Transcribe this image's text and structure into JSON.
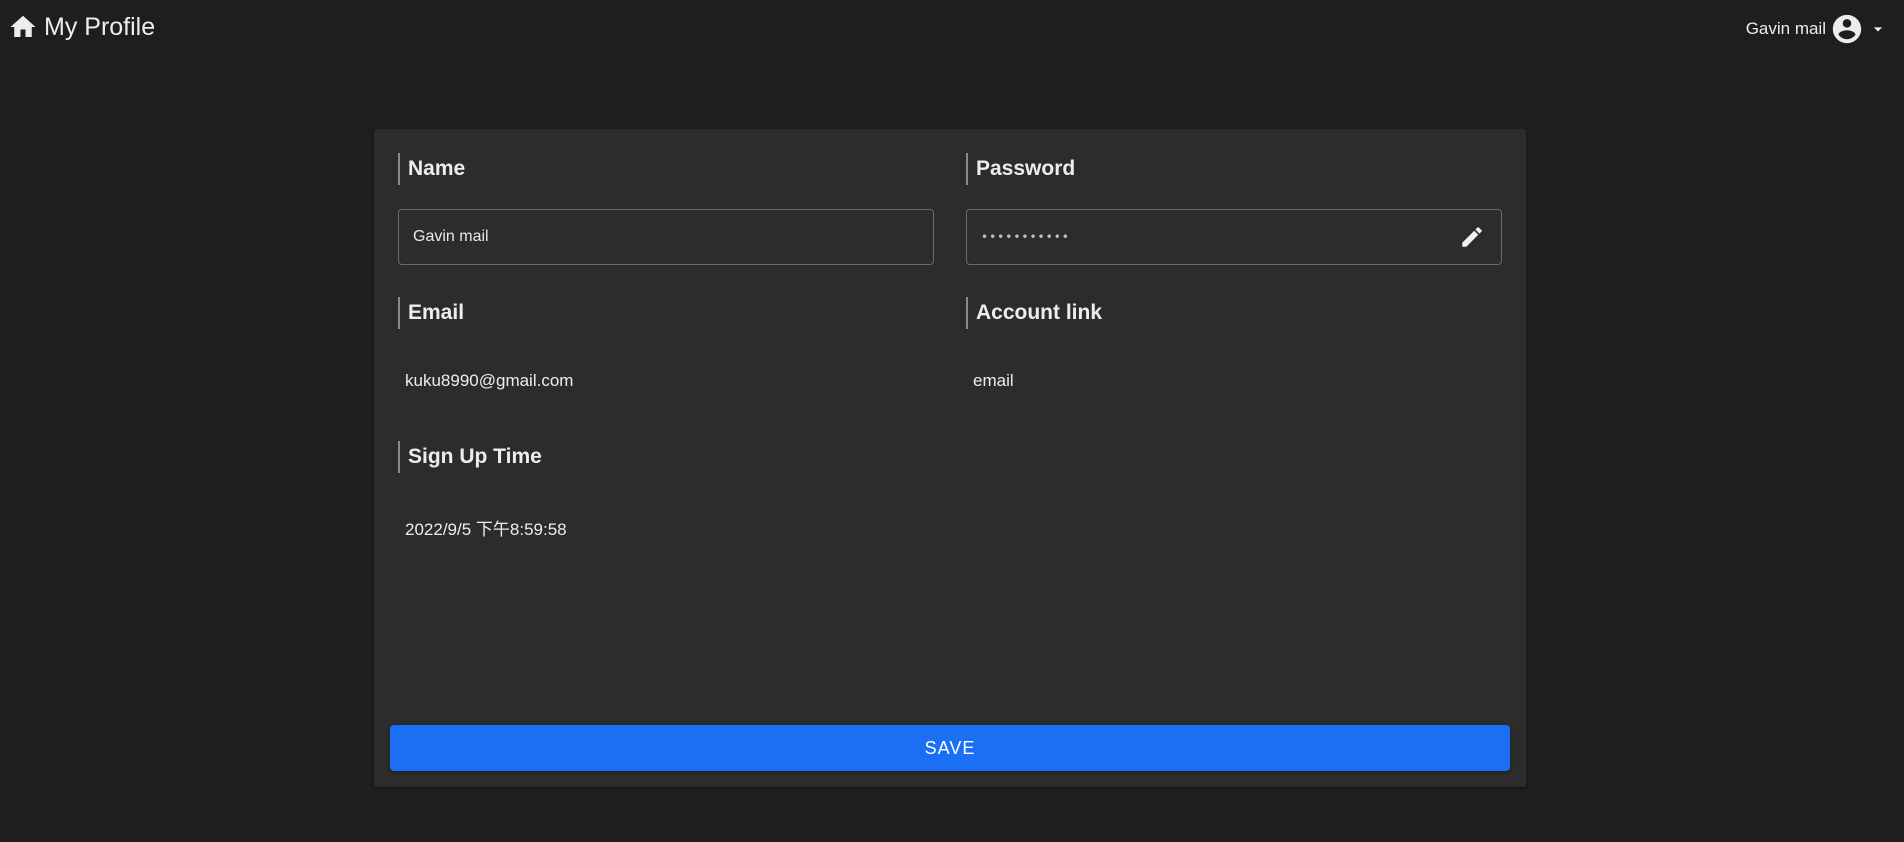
{
  "header": {
    "title": "My Profile",
    "home_icon": "home-icon",
    "user_name": "Gavin mail",
    "avatar_icon": "account-circle-icon",
    "menu_icon": "caret-down-icon"
  },
  "profile": {
    "name": {
      "label": "Name",
      "value": "Gavin mail"
    },
    "password": {
      "label": "Password",
      "value": "•••••••••••",
      "edit_icon": "pencil-icon"
    },
    "email": {
      "label": "Email",
      "value": "kuku8990@gmail.com"
    },
    "account_link": {
      "label": "Account link",
      "value": "email"
    },
    "sign_up_time": {
      "label": "Sign Up Time",
      "value": "2022/9/5 下午8:59:58"
    }
  },
  "actions": {
    "save_label": "SAVE"
  },
  "colors": {
    "background": "#1e1e1e",
    "card": "#2c2c2c",
    "accent": "#1a6ff5"
  }
}
